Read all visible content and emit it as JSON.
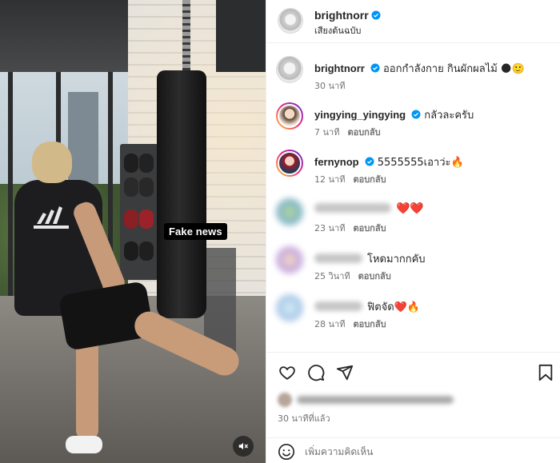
{
  "video": {
    "caption": "Fake news",
    "mute_icon": "speaker-muted-icon"
  },
  "post": {
    "author": "brightnorr",
    "audio_label": "เสียงต้นฉบับ"
  },
  "comments": [
    {
      "user": "brightnorr",
      "text": "ออกกำลังกาย กินผักผลไม้ 🌑🙂",
      "time": "30 นาที",
      "reply": "",
      "blurred": false
    },
    {
      "user": "yingying_yingying",
      "text": "กลัวละครับ",
      "time": "7 นาที",
      "reply": "ตอบกลับ",
      "blurred": false
    },
    {
      "user": "fernynop",
      "text": "5555555เอาว่ะ🔥",
      "time": "12 นาที",
      "reply": "ตอบกลับ",
      "blurred": false
    },
    {
      "user": "",
      "text": "❤️❤️",
      "time": "23 นาที",
      "reply": "ตอบกลับ",
      "blurred": true
    },
    {
      "user": "",
      "text": "โหดมากกคับ",
      "time": "25 วินาที",
      "reply": "ตอบกลับ",
      "blurred": true
    },
    {
      "user": "",
      "text": "ฟิตจัด❤️🔥",
      "time": "28 นาที",
      "reply": "ตอบกลับ",
      "blurred": true
    }
  ],
  "actions": {
    "like_icon": "heart-icon",
    "comment_icon": "comment-icon",
    "share_icon": "share-icon",
    "save_icon": "bookmark-icon",
    "time_ago": "30 นาทีที่แล้ว"
  },
  "composer": {
    "placeholder": "เพิ่มความคิดเห็น",
    "emoji_icon": "emoji-icon"
  },
  "colors": {
    "verified": "#0095f6",
    "secondary_text": "#737373",
    "divider": "#efefef"
  }
}
